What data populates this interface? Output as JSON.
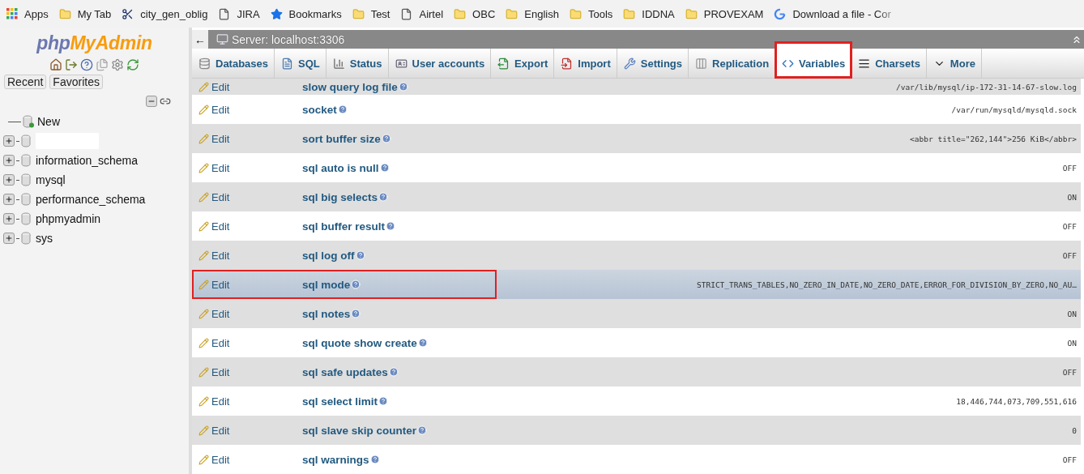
{
  "bookmarks": [
    {
      "label": "Apps",
      "kind": "apps"
    },
    {
      "label": "My Tab",
      "kind": "folder"
    },
    {
      "label": "city_gen_oblig",
      "kind": "tool"
    },
    {
      "label": "JIRA",
      "kind": "page"
    },
    {
      "label": "Bookmarks",
      "kind": "star"
    },
    {
      "label": "Test",
      "kind": "folder"
    },
    {
      "label": "Airtel",
      "kind": "page"
    },
    {
      "label": "OBC",
      "kind": "folder"
    },
    {
      "label": "English",
      "kind": "folder"
    },
    {
      "label": "Tools",
      "kind": "folder"
    },
    {
      "label": "IDDNA",
      "kind": "folder"
    },
    {
      "label": "PROVEXAM",
      "kind": "folder"
    },
    {
      "label": "Download a file - Cor",
      "kind": "google"
    }
  ],
  "sidebar": {
    "logo_parts": [
      "php",
      "MyAdmin"
    ],
    "tabs": [
      {
        "label": "Recent"
      },
      {
        "label": "Favorites"
      }
    ],
    "tree": [
      {
        "name": "New",
        "kind": "new"
      },
      {
        "kind": "redacted"
      },
      {
        "name": "information_schema",
        "kind": "database"
      },
      {
        "name": "mysql",
        "kind": "database"
      },
      {
        "name": "performance_schema",
        "kind": "database"
      },
      {
        "name": "phpmyadmin",
        "kind": "database"
      },
      {
        "name": "sys",
        "kind": "database"
      }
    ]
  },
  "server_bar": {
    "back": "←",
    "title": "Server: localhost:3306"
  },
  "tabs": [
    {
      "label": "Databases",
      "kind": "databases",
      "selected": false,
      "annotated": false
    },
    {
      "label": "SQL",
      "kind": "sql",
      "selected": false,
      "annotated": false
    },
    {
      "label": "Status",
      "kind": "status",
      "selected": false,
      "annotated": false
    },
    {
      "label": "User accounts",
      "kind": "users",
      "selected": false,
      "annotated": false
    },
    {
      "label": "Export",
      "kind": "export",
      "selected": false,
      "annotated": false
    },
    {
      "label": "Import",
      "kind": "import",
      "selected": false,
      "annotated": false
    },
    {
      "label": "Settings",
      "kind": "settings",
      "selected": false,
      "annotated": false
    },
    {
      "label": "Replication",
      "kind": "replication",
      "selected": false,
      "annotated": false
    },
    {
      "label": "Variables",
      "kind": "variables",
      "selected": true,
      "annotated": true
    },
    {
      "label": "Charsets",
      "kind": "charsets",
      "selected": false,
      "annotated": false
    },
    {
      "label": "More",
      "kind": "more",
      "selected": false,
      "annotated": false
    }
  ],
  "variables": [
    {
      "action": "Edit",
      "name": "slow query log file",
      "value": "/var/lib/mysql/ip-172-31-14-67-slow.log",
      "selected": false,
      "annotated": false
    },
    {
      "action": "Edit",
      "name": "socket",
      "value": "/var/run/mysqld/mysqld.sock",
      "selected": false,
      "annotated": false
    },
    {
      "action": "Edit",
      "name": "sort buffer size",
      "value": "<abbr title=\"262,144\">256 KiB</abbr>",
      "selected": false,
      "annotated": false
    },
    {
      "action": "Edit",
      "name": "sql auto is null",
      "value": "OFF",
      "selected": false,
      "annotated": false
    },
    {
      "action": "Edit",
      "name": "sql big selects",
      "value": "ON",
      "selected": false,
      "annotated": false
    },
    {
      "action": "Edit",
      "name": "sql buffer result",
      "value": "OFF",
      "selected": false,
      "annotated": false
    },
    {
      "action": "Edit",
      "name": "sql log off",
      "value": "OFF",
      "selected": false,
      "annotated": false
    },
    {
      "action": "Edit",
      "name": "sql mode",
      "value": "STRICT_TRANS_TABLES,NO_ZERO_IN_DATE,NO_ZERO_DATE,ERROR_FOR_DIVISION_BY_ZERO,NO_AU…",
      "selected": true,
      "annotated": true
    },
    {
      "action": "Edit",
      "name": "sql notes",
      "value": "ON",
      "selected": false,
      "annotated": false
    },
    {
      "action": "Edit",
      "name": "sql quote show create",
      "value": "ON",
      "selected": false,
      "annotated": false
    },
    {
      "action": "Edit",
      "name": "sql safe updates",
      "value": "OFF",
      "selected": false,
      "annotated": false
    },
    {
      "action": "Edit",
      "name": "sql select limit",
      "value": "18,446,744,073,709,551,616",
      "selected": false,
      "annotated": false
    },
    {
      "action": "Edit",
      "name": "sql slave skip counter",
      "value": "0",
      "selected": false,
      "annotated": false
    },
    {
      "action": "Edit",
      "name": "sql warnings",
      "value": "OFF",
      "selected": false,
      "annotated": false
    }
  ]
}
